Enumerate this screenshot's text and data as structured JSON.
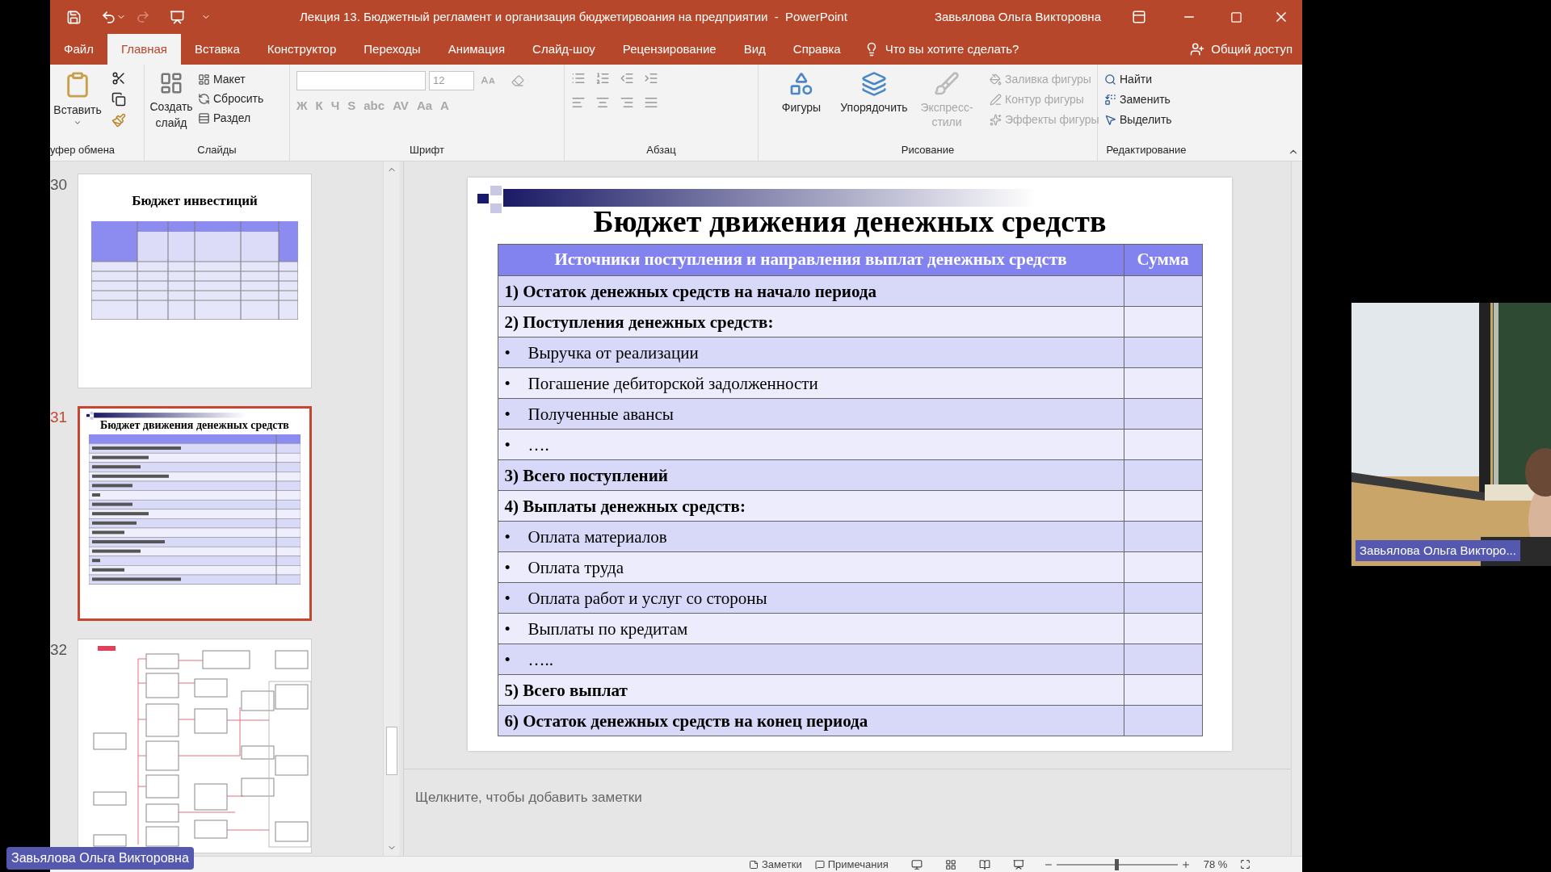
{
  "window": {
    "title": "Лекция 13. Бюджетный регламент и организация бюджетирвоания на предприятии  -  PowerPoint",
    "user": "Завьялова Ольга Викторовна"
  },
  "tabs": [
    {
      "label": "Файл",
      "selected": false
    },
    {
      "label": "Главная",
      "selected": true
    },
    {
      "label": "Вставка",
      "selected": false
    },
    {
      "label": "Конструктор",
      "selected": false
    },
    {
      "label": "Переходы",
      "selected": false
    },
    {
      "label": "Анимация",
      "selected": false
    },
    {
      "label": "Слайд-шоу",
      "selected": false
    },
    {
      "label": "Рецензирование",
      "selected": false
    },
    {
      "label": "Вид",
      "selected": false
    },
    {
      "label": "Справка",
      "selected": false
    }
  ],
  "tell_me": "Что вы хотите сделать?",
  "share": "Общий доступ",
  "ribbon": {
    "clipboard": {
      "title": "уфер обмена",
      "paste": "Вставить"
    },
    "slides": {
      "title": "Слайды",
      "new_slide": [
        "Создать",
        "слайд"
      ],
      "items": [
        "Макет",
        "Сбросить",
        "Раздел"
      ]
    },
    "font": {
      "title": "Шрифт",
      "size": "12",
      "buttons": [
        {
          "label": "Ж",
          "disabled": true
        },
        {
          "label": "К",
          "disabled": true
        },
        {
          "label": "Ч",
          "disabled": true
        },
        {
          "label": "S",
          "disabled": true
        },
        {
          "label": "abc",
          "disabled": true
        },
        {
          "label": "AV",
          "disabled": true
        },
        {
          "label": "Aa",
          "disabled": true
        },
        {
          "label": "A",
          "disabled": true
        }
      ]
    },
    "paragraph": {
      "title": "Абзац"
    },
    "drawing": {
      "title": "Рисование",
      "large": [
        {
          "label": "Фигуры",
          "disabled": false
        },
        {
          "label": "Упорядочить",
          "disabled": false
        },
        {
          "label": "Экспресс-стили",
          "disabled": true
        }
      ],
      "small": [
        {
          "label": "Заливка фигуры",
          "disabled": true
        },
        {
          "label": "Контур фигуры",
          "disabled": true
        },
        {
          "label": "Эффекты фигуры",
          "disabled": true
        }
      ]
    },
    "editing": {
      "title": "Редактирование",
      "items": [
        "Найти",
        "Заменить",
        "Выделить"
      ]
    }
  },
  "thumbnails": [
    {
      "number": "30",
      "selected": false,
      "kind": "table",
      "title": "Бюджет инвестиций"
    },
    {
      "number": "31",
      "selected": true,
      "kind": "list",
      "title": "Бюджет движения денежных средств"
    },
    {
      "number": "32",
      "selected": false,
      "kind": "diagram"
    }
  ],
  "slide": {
    "title": "Бюджет движения денежных средств",
    "columns": [
      "Источники поступления и направления выплат денежных средств",
      "Сумма"
    ],
    "rows": [
      {
        "kind": "heading",
        "text": "1) Остаток денежных средств на начало периода"
      },
      {
        "kind": "heading",
        "text": "2) Поступления денежных средств:"
      },
      {
        "kind": "bullet",
        "marker": "•",
        "text": "Выручка от реализации"
      },
      {
        "kind": "bullet",
        "marker": "•",
        "text": "Погашение дебиторской задолженности"
      },
      {
        "kind": "bullet",
        "marker": "•",
        "text": "Полученные авансы"
      },
      {
        "kind": "bullet",
        "marker": "•",
        "text": "…."
      },
      {
        "kind": "heading",
        "text": "3) Всего поступлений"
      },
      {
        "kind": "heading",
        "text": "4) Выплаты денежных средств:"
      },
      {
        "kind": "bullet",
        "marker": "•",
        "text": "Оплата материалов"
      },
      {
        "kind": "bullet",
        "marker": "•",
        "text": "Оплата труда"
      },
      {
        "kind": "bullet",
        "marker": "•",
        "text": "Оплата работ и услуг со стороны"
      },
      {
        "kind": "bullet",
        "marker": "•",
        "text": "Выплаты по кредитам"
      },
      {
        "kind": "bullet",
        "marker": "•",
        "text": "….."
      },
      {
        "kind": "heading",
        "text": "5) Всего выплат"
      },
      {
        "kind": "heading",
        "text": "6) Остаток денежных средств на конец периода"
      }
    ]
  },
  "notes": {
    "placeholder": "Щелкните, чтобы добавить заметки"
  },
  "status_bar": {
    "notes": "Заметки",
    "comments": "Примечания",
    "zoom": "78 %",
    "zoom_slider": {
      "level": 0.5
    }
  },
  "video": {
    "name": "Завьялова Ольга Викторо..."
  },
  "speaker_tag": "Завьялова Ольга Викторовна"
}
